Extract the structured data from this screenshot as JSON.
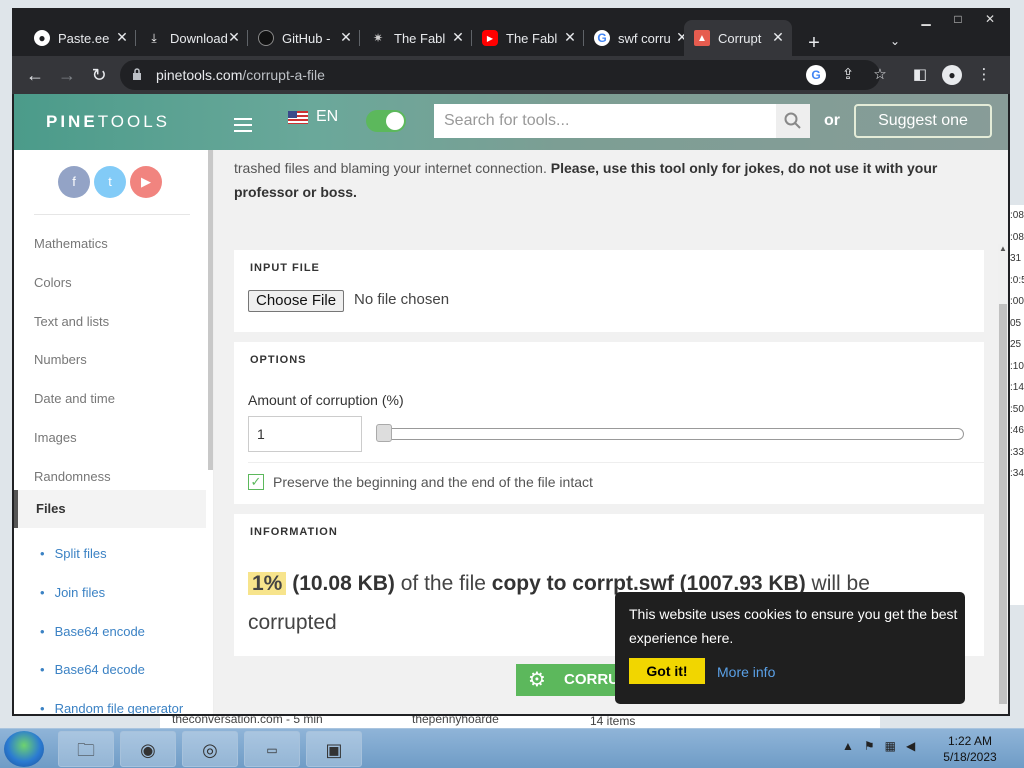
{
  "browser": {
    "tabs": [
      {
        "title": "Paste.ee"
      },
      {
        "title": "Download"
      },
      {
        "title": "GitHub -"
      },
      {
        "title": "The Fabl"
      },
      {
        "title": "The Fabl"
      },
      {
        "title": "swf corru"
      },
      {
        "title": "Corrupt"
      }
    ],
    "address": {
      "host": "pinetools.com",
      "path": "/corrupt-a-file"
    }
  },
  "site": {
    "logo_bold": "PINE",
    "logo_light": "TOOLS",
    "lang": "EN",
    "search_placeholder": "Search for tools...",
    "or": "or",
    "suggest": "Suggest one"
  },
  "sidebar": {
    "categories": [
      "Mathematics",
      "Colors",
      "Text and lists",
      "Numbers",
      "Date and time",
      "Images",
      "Randomness"
    ],
    "active": "Files",
    "sub_items": [
      "Split files",
      "Join files",
      "Base64 encode",
      "Base64 decode",
      "Random file generator"
    ]
  },
  "main": {
    "intro_plain": "trashed files and blaming your internet connection. ",
    "intro_bold": "Please, use this tool only for jokes, do not use it with your professor or boss.",
    "input_file": {
      "label": "INPUT FILE",
      "button": "Choose File",
      "status": "No file chosen"
    },
    "options": {
      "label": "OPTIONS",
      "amount_label": "Amount of corruption (%)",
      "amount_value": "1",
      "slider_percent": 1,
      "preserve_label": "Preserve the beginning and the end of the file intact",
      "preserve_checked": true
    },
    "information": {
      "label": "INFORMATION",
      "pct": "1%",
      "size": "(10.08 KB)",
      "of_the_file": " of the file ",
      "filename": "copy to corrpt.swf (1007.93 KB)",
      "will_be": " will be corrupted"
    },
    "corrupt_button": "CORRUPT"
  },
  "cookie": {
    "message": "This website uses cookies to ensure you get the best experience here.",
    "got_it": "Got it!",
    "more_info": "More info"
  },
  "background": {
    "strip_text_1": "theconversation.com - 5 min",
    "strip_text_2": "thepennyhoarde",
    "strip_text_3": "14 items"
  },
  "taskbar": {
    "time": "1:22 AM",
    "date": "5/18/2023"
  }
}
